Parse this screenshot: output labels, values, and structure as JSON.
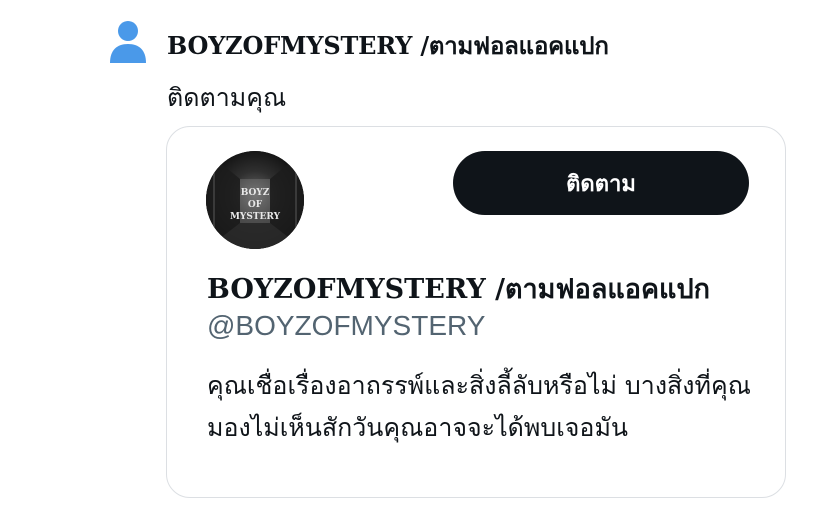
{
  "notification": {
    "icon": "person-icon",
    "title": "BOYZOFMYSTERY /ตามฟอลแอคแปก",
    "subtitle": "ติดตามคุณ"
  },
  "card": {
    "avatar": {
      "icon": "profile-avatar",
      "lines": [
        "BOYZ",
        "OF",
        "MYSTERY"
      ]
    },
    "follow_label": "ติดตาม",
    "name": "BOYZOFMYSTERY /ตามฟอลแอคแปก",
    "handle": "@BOYZOFMYSTERY",
    "bio": "คุณเชื่อเรื่องอาถรรพ์และสิ่งลี้ลับหรือไม่ บางสิ่งที่คุณมองไม่เห็นสักวันคุณอาจจะได้พบเจอมัน"
  },
  "colors": {
    "icon_blue": "#4a99e9",
    "button_bg": "#0f1419",
    "handle_gray": "#536471",
    "card_border": "#dcdfe3"
  }
}
